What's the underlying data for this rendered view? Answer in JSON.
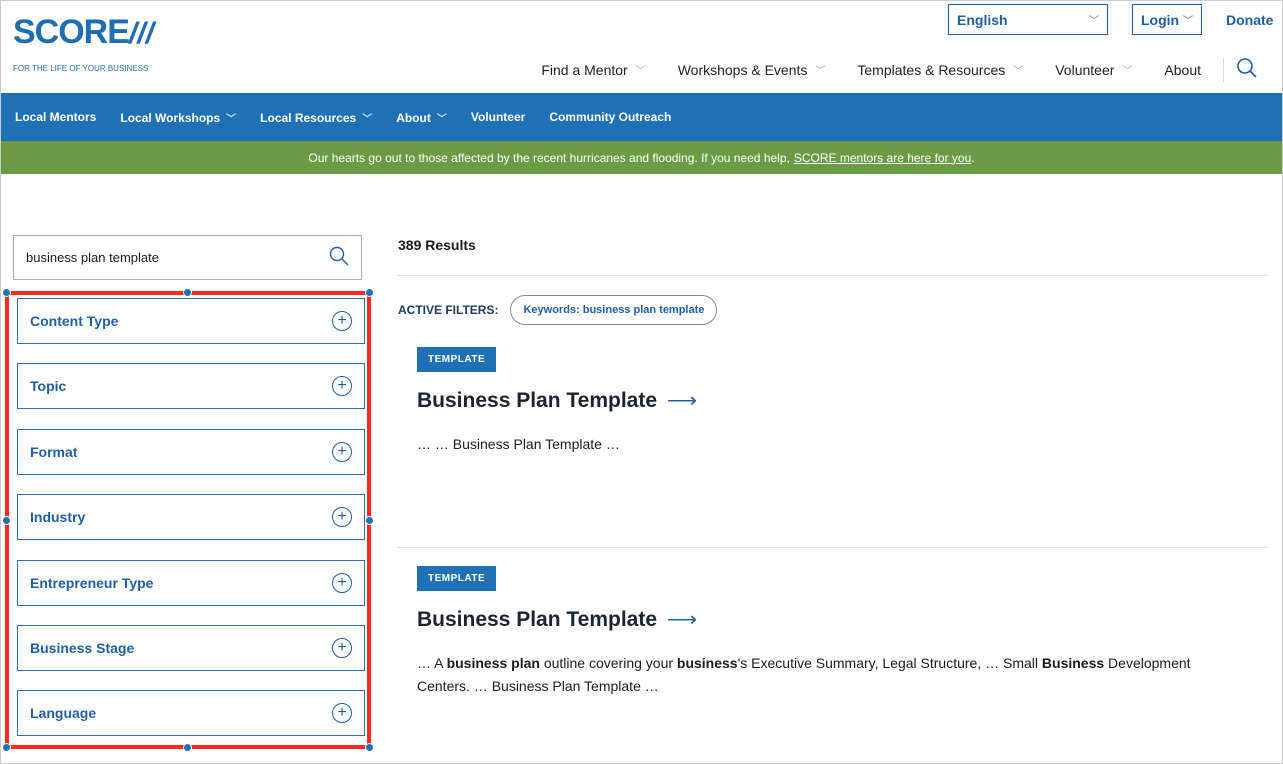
{
  "logo": {
    "name": "SCORE",
    "tagline": "FOR THE LIFE OF YOUR BUSINESS"
  },
  "utility": {
    "language": "English",
    "login": "Login",
    "donate": "Donate"
  },
  "main_nav": [
    "Find a Mentor",
    "Workshops & Events",
    "Templates & Resources",
    "Volunteer",
    "About"
  ],
  "local_nav": [
    {
      "label": "Local Mentors",
      "dropdown": false
    },
    {
      "label": "Local Workshops",
      "dropdown": true
    },
    {
      "label": "Local Resources",
      "dropdown": true
    },
    {
      "label": "About",
      "dropdown": true
    },
    {
      "label": "Volunteer",
      "dropdown": false
    },
    {
      "label": "Community Outreach",
      "dropdown": false
    }
  ],
  "banner": {
    "text": "Our hearts go out to those affected by the recent hurricanes and flooding. If you need help,",
    "link": "SCORE mentors are here for you",
    "end": "."
  },
  "search": {
    "value": "business plan template"
  },
  "facets": [
    "Content Type",
    "Topic",
    "Format",
    "Industry",
    "Entrepreneur Type",
    "Business Stage",
    "Language"
  ],
  "results": {
    "count": "389 Results",
    "active_label": "ACTIVE FILTERS:",
    "active_filter": "Keywords: business plan template",
    "items": [
      {
        "badge": "TEMPLATE",
        "title": "Business Plan Template",
        "snippet": "… … Business Plan Template …"
      },
      {
        "badge": "TEMPLATE",
        "title": "Business Plan Template",
        "snippet_parts": [
          "… A ",
          "business plan",
          " outline covering your ",
          "business",
          "'s Executive Summary, Legal Structure, … Small ",
          "Business",
          " Development Centers. … Business Plan Template …"
        ]
      }
    ]
  }
}
